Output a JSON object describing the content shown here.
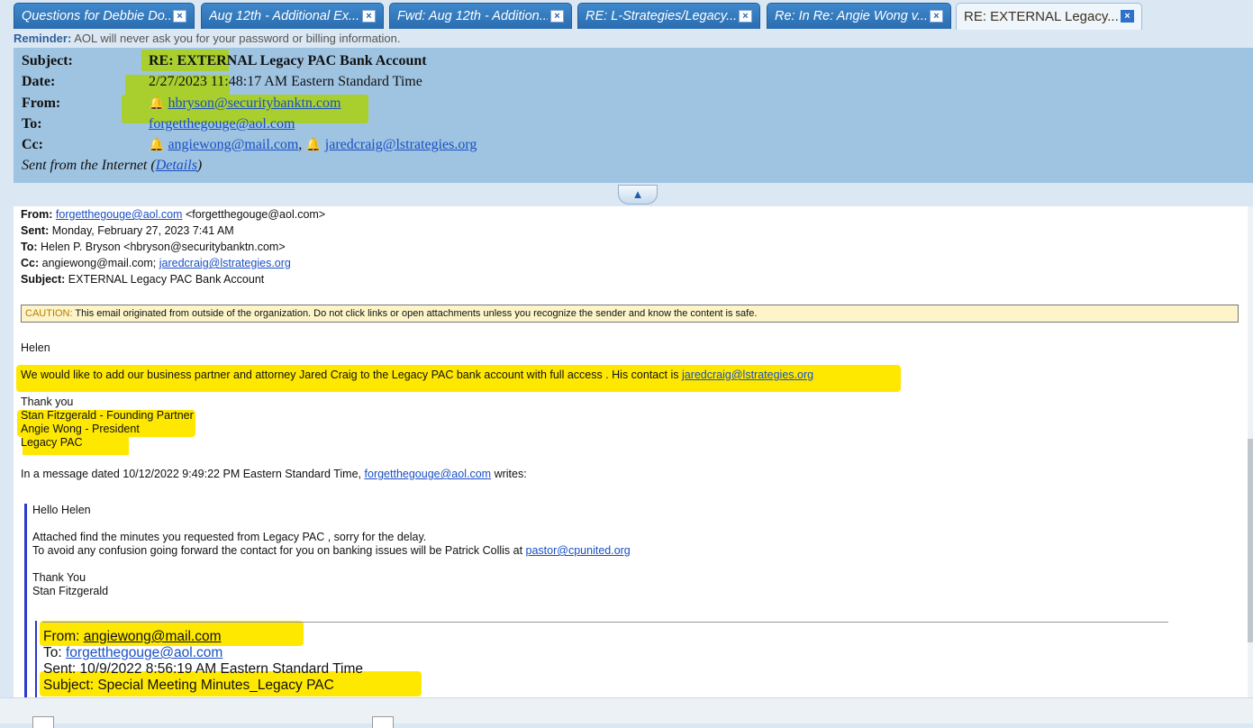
{
  "tabs": [
    {
      "label": "Questions for Debbie Do..."
    },
    {
      "label": "Aug 12th - Additional Ex..."
    },
    {
      "label": "Fwd: Aug 12th - Addition..."
    },
    {
      "label": "RE: L-Strategies/Legacy..."
    },
    {
      "label": "Re: In Re: Angie Wong v...."
    },
    {
      "label": "RE: EXTERNAL Legacy..."
    }
  ],
  "tab_close": "×",
  "reminder": {
    "label": "Reminder:",
    "text": "AOL will never ask you for your password or billing information."
  },
  "header": {
    "subject_label": "Subject:",
    "subject": "RE: EXTERNAL Legacy PAC Bank Account",
    "date_label": "Date:",
    "date": "2/27/2023 11:48:17 AM Eastern Standard Time",
    "from_label": "From:",
    "from": "hbryson@securitybanktn.com",
    "to_label": "To:",
    "to": "forgetthegouge@aol.com",
    "cc_label": "Cc:",
    "cc1": "angiewong@mail.com",
    "cc_sep": ",",
    "cc2": "jaredcraig@lstrategies.org",
    "sent_prefix": "Sent from the Internet (",
    "details": "Details",
    "sent_suffix": ")"
  },
  "collapse_glyph": "▲",
  "bell_glyph": "🔔",
  "message": {
    "from_label": "From:",
    "from_link": "forgetthegouge@aol.com",
    "from_rest": "<forgetthegouge@aol.com>",
    "sent_label": "Sent:",
    "sent": "Monday, February 27, 2023 7:41 AM",
    "to_label": "To:",
    "to": "Helen P. Bryson <hbryson@securitybanktn.com>",
    "cc_label": "Cc:",
    "cc_text": "angiewong@mail.com;",
    "cc_link": "jaredcraig@lstrategies.org",
    "subject_label": "Subject:",
    "subject": "EXTERNAL Legacy PAC Bank Account",
    "caution_label": "CAUTION:",
    "caution_text": "This email originated from outside of the organization. Do not click links or open attachments unless you recognize the sender and know the content is safe.",
    "greeting": "Helen",
    "para": "We would like to add our business partner and attorney Jared Craig to the Legacy PAC bank account with full access . His contact is",
    "para_link": "jaredcraig@lstrategies.org",
    "thanks": "Thank you",
    "sig1": "Stan Fitzgerald - Founding Partner",
    "sig2": "Angie Wong - President",
    "sig3": "Legacy PAC",
    "quote_intro": "In a message dated 10/12/2022 9:49:22 PM Eastern Standard Time,",
    "quote_link": "forgetthegouge@aol.com",
    "quote_suffix": "writes:"
  },
  "quoted": {
    "greeting": "Hello Helen",
    "line1": "Attached find the minutes you requested from Legacy PAC , sorry for the delay.",
    "line2": "To avoid any confusion going forward the contact for you on banking issues will be Patrick Collis at",
    "line2_link": "pastor@cpunited.org",
    "thanks": "Thank You",
    "sig": "Stan Fitzgerald"
  },
  "nested": {
    "from_label": "From:",
    "from": "angiewong@mail.com",
    "to_label": "To:",
    "to": "forgetthegouge@aol.com",
    "sent_label": "Sent:",
    "sent": "10/9/2022 8:56:19 AM Eastern Standard Time",
    "subject_label": "Subject:",
    "subject": "Special Meeting Minutes_Legacy PAC"
  }
}
